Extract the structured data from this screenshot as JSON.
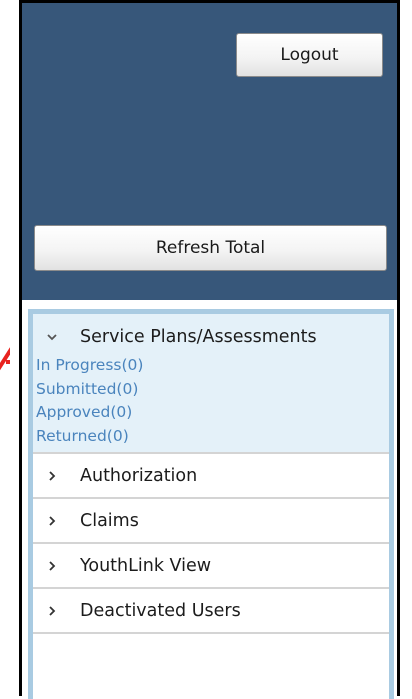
{
  "header": {
    "logout_label": "Logout",
    "refresh_label": "Refresh Total",
    "background_color": "#37577a"
  },
  "sidebar": {
    "border_color": "#a9cbe2",
    "expanded_section": {
      "label": "Service Plans/Assessments",
      "icon": "chevron-down-icon",
      "links": [
        {
          "label": "In Progress(0)"
        },
        {
          "label": "Submitted(0)"
        },
        {
          "label": "Approved(0)"
        },
        {
          "label": "Returned(0)"
        }
      ]
    },
    "collapsed_sections": [
      {
        "label": "Authorization",
        "icon": "chevron-right-icon"
      },
      {
        "label": "Claims",
        "icon": "chevron-right-icon"
      },
      {
        "label": "YouthLink View",
        "icon": "chevron-right-icon"
      },
      {
        "label": "Deactivated Users",
        "icon": "chevron-right-icon"
      }
    ]
  },
  "colors": {
    "link": "#4a84bd",
    "annotation_red": "#e8231f"
  }
}
